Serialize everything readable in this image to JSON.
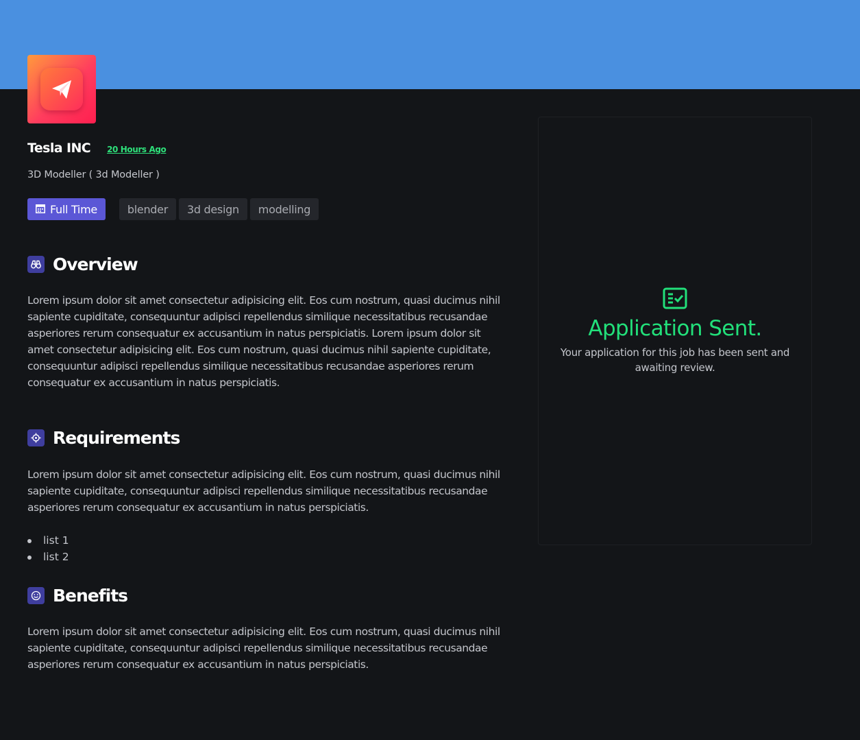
{
  "header": {
    "banner_color": "#4a90e0",
    "logo_icon": "paper-plane-icon"
  },
  "company": {
    "name": "Tesla INC",
    "posted": "20 Hours Ago"
  },
  "job": {
    "role": "3D Modeller ( 3d Modeller )",
    "type_label": "Full Time",
    "type_icon": "calendar-icon",
    "tags": [
      "blender",
      "3d design",
      "modelling"
    ]
  },
  "sections": {
    "overview": {
      "title": "Overview",
      "icon": "binoculars-icon",
      "text": "Lorem ipsum dolor sit amet consectetur adipisicing elit. Eos cum nostrum, quasi ducimus nihil sapiente cupiditate, consequuntur adipisci repellendus similique necessitatibus recusandae asperiores rerum consequatur ex accusantium in natus perspiciatis. Lorem ipsum dolor sit amet consectetur adipisicing elit. Eos cum nostrum, quasi ducimus nihil sapiente cupiditate, consequuntur adipisci repellendus similique necessitatibus recusandae asperiores rerum consequatur ex accusantium in natus perspiciatis."
    },
    "requirements": {
      "title": "Requirements",
      "icon": "crosshair-icon",
      "text": "Lorem ipsum dolor sit amet consectetur adipisicing elit. Eos cum nostrum, quasi ducimus nihil sapiente cupiditate, consequuntur adipisci repellendus similique necessitatibus recusandae asperiores rerum consequatur ex accusantium in natus perspiciatis.",
      "items": [
        "list 1",
        "list 2"
      ]
    },
    "benefits": {
      "title": "Benefits",
      "icon": "smile-icon",
      "text": "Lorem ipsum dolor sit amet consectetur adipisicing elit. Eos cum nostrum, quasi ducimus nihil sapiente cupiditate, consequuntur adipisci repellendus similique necessitatibus recusandae asperiores rerum consequatur ex accusantium in natus perspiciatis."
    }
  },
  "application": {
    "icon": "checklist-icon",
    "title": "Application Sent.",
    "message": "Your application for this job has been sent and awaiting review.",
    "accent_color": "#22e07a"
  },
  "colors": {
    "background": "#131518",
    "badge": "#5b57d6",
    "section_icon_bg": "#3f3e9e",
    "posted_text": "#2ee07a"
  }
}
